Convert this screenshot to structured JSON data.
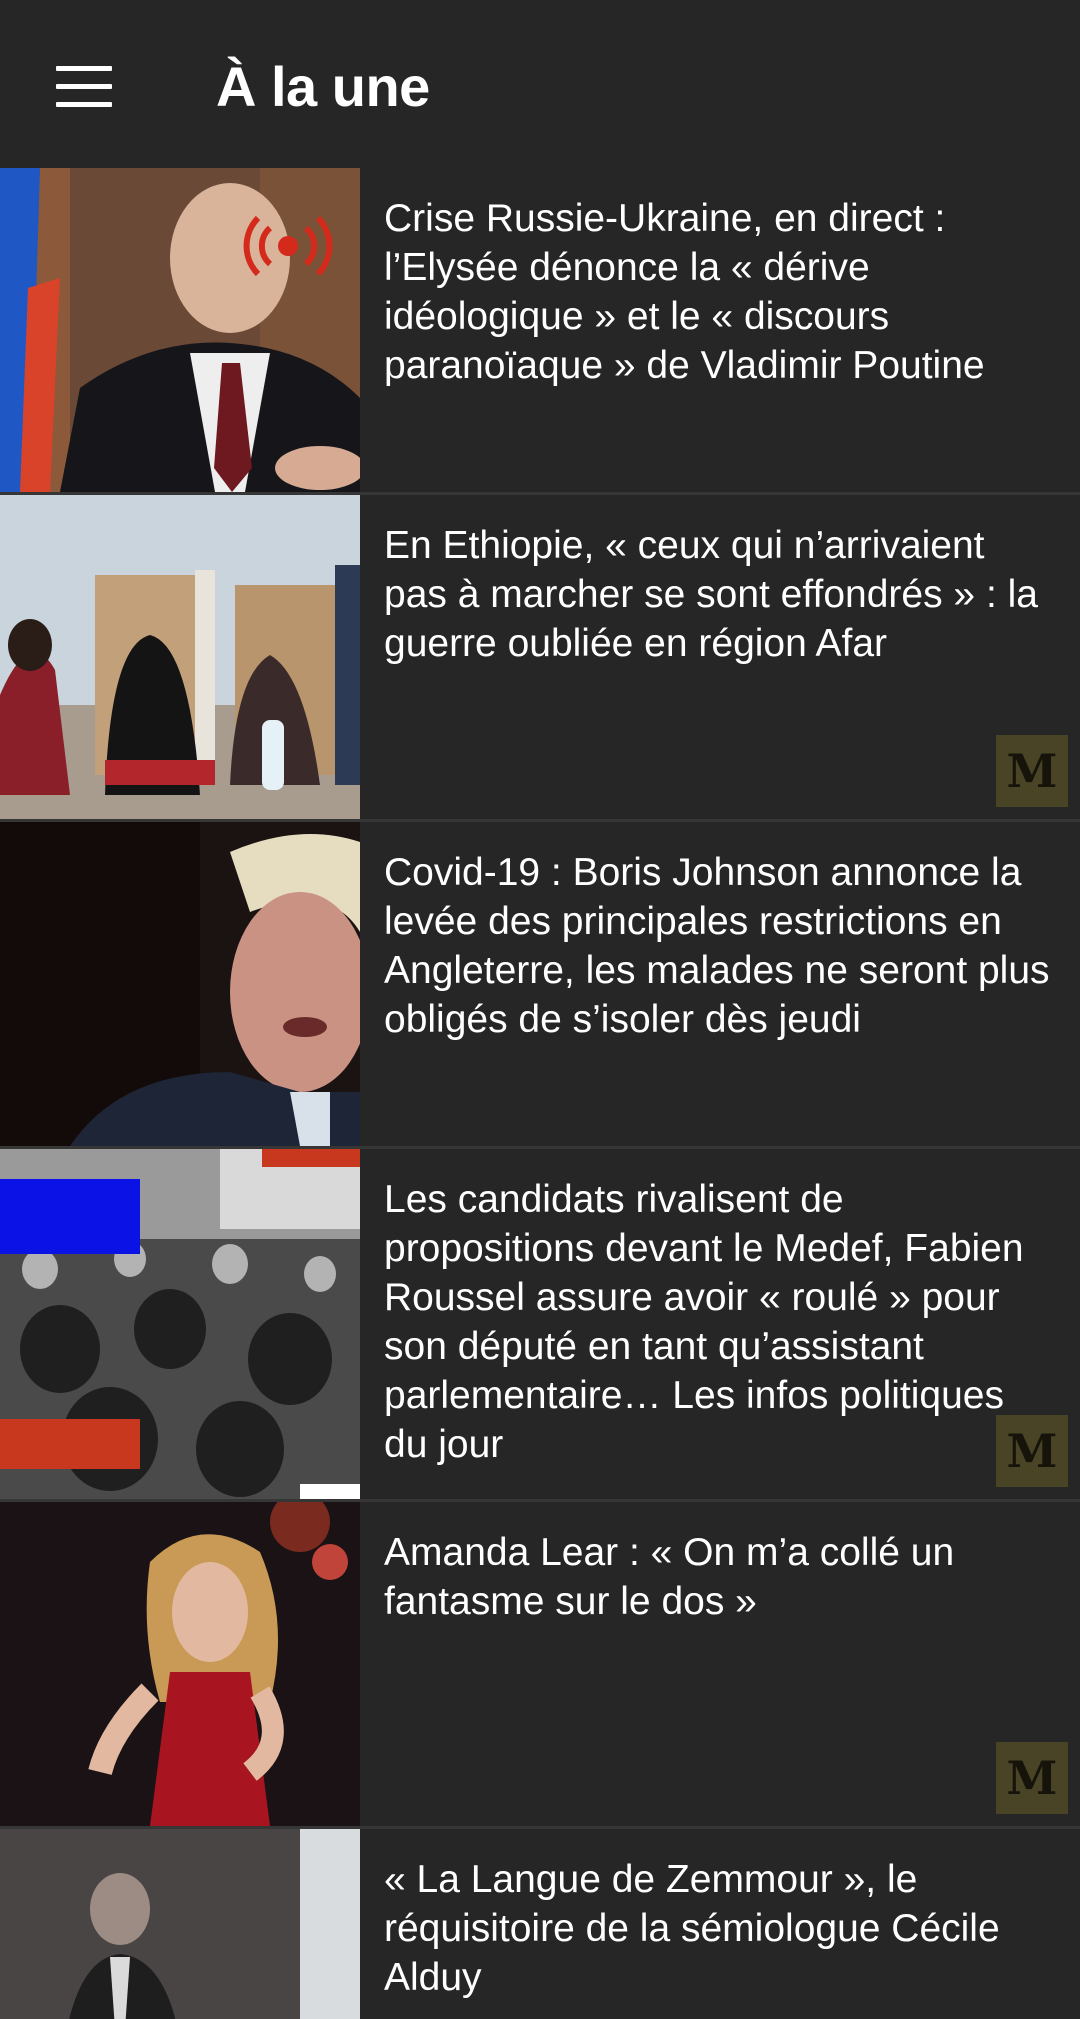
{
  "app_bar": {
    "title": "À la une",
    "menu_icon": "hamburger-menu-icon"
  },
  "articles": [
    {
      "headline": "Crise Russie-Ukraine, en direct : l’Elysée dénonce la « dérive idéologique » et le « discours paranoïaque » de Vladimir Poutine",
      "live": true,
      "badge": ""
    },
    {
      "headline": "En Ethiopie, « ceux qui n’arrivaient pas à marcher se sont effondrés » : la guerre oubliée en région Afar",
      "live": false,
      "badge": "M"
    },
    {
      "headline": "Covid-19 : Boris Johnson annonce la levée des principales restrictions en Angleterre, les malades ne seront plus obligés de s’isoler dès jeudi",
      "live": false,
      "badge": ""
    },
    {
      "headline": "Les candidats rivalisent de propositions devant le Medef, Fabien Roussel assure avoir « roulé » pour son député en tant qu’assistant parlementaire… Les infos politiques du jour",
      "live": false,
      "badge": "M"
    },
    {
      "headline": "Amanda Lear : « On m’a collé un fantasme sur le dos »",
      "live": false,
      "badge": "M"
    },
    {
      "headline": "« La Langue de Zemmour », le réquisitoire de la sémiologue Cécile Alduy",
      "live": false,
      "badge": ""
    }
  ],
  "colors": {
    "background": "#262626",
    "divider": "#363636",
    "live_red": "#d42a1c",
    "badge_bg": "#4a4427"
  }
}
